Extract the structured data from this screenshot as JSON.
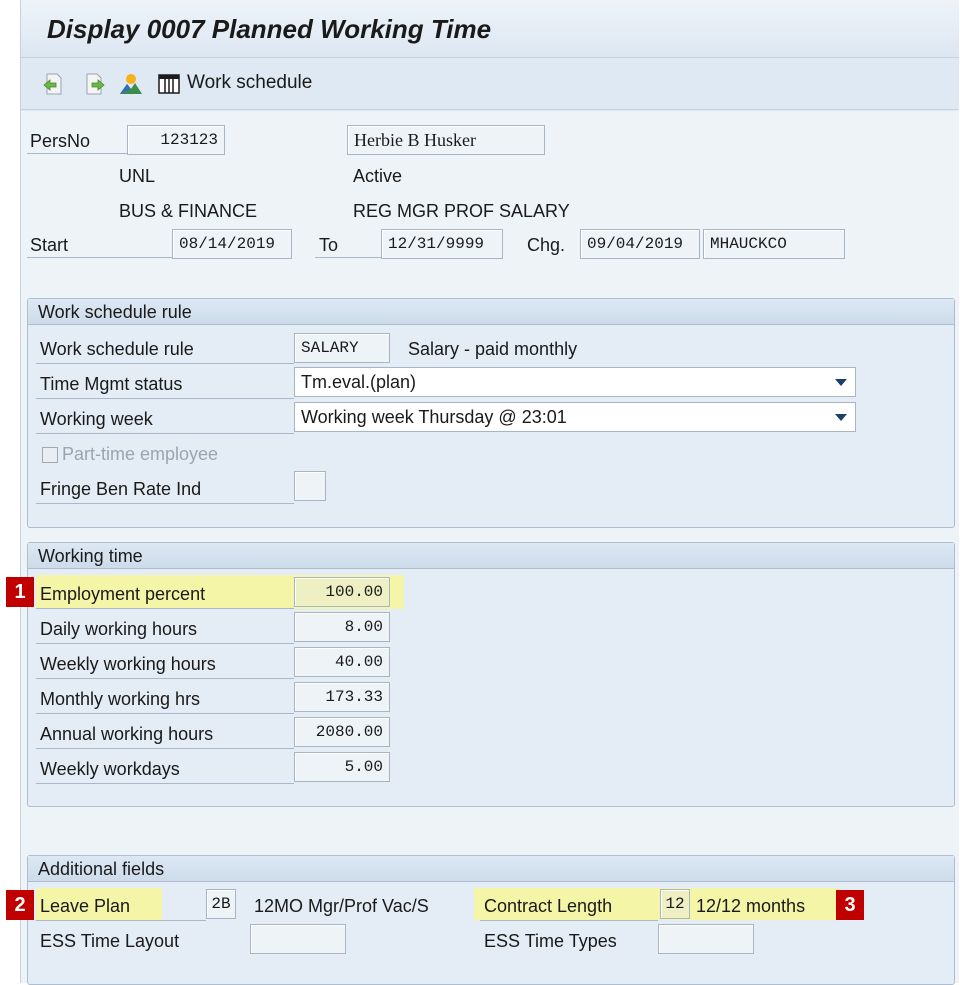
{
  "window": {
    "title": "Display 0007 Planned Working Time"
  },
  "toolbar": {
    "icons": [
      "previous-record-icon",
      "next-record-icon",
      "overview-icon",
      "work-schedule-icon"
    ],
    "work_schedule_label": "Work schedule"
  },
  "header": {
    "persno_label": "PersNo",
    "persno_value": "123123",
    "name_value": "Herbie B Husker",
    "org_unit": "UNL",
    "status": "Active",
    "department": "BUS & FINANCE",
    "position": "REG MGR PROF SALARY",
    "start_label": "Start",
    "start_value": "08/14/2019",
    "to_label": "To",
    "to_value": "12/31/9999",
    "chg_label": "Chg.",
    "chg_date": "09/04/2019",
    "chg_user": "MHAUCKCO"
  },
  "work_schedule_rule": {
    "group_title": "Work schedule rule",
    "rule_label": "Work schedule rule",
    "rule_value": "SALARY",
    "rule_desc": "Salary - paid monthly",
    "tm_status_label": "Time Mgmt status",
    "tm_status_value": "Tm.eval.(plan)",
    "working_week_label": "Working week",
    "working_week_value": "Working week Thursday @ 23:01",
    "part_time_label": "Part-time employee",
    "fringe_label": "Fringe Ben Rate Ind",
    "fringe_value": ""
  },
  "working_time": {
    "group_title": "Working time",
    "rows": [
      {
        "label": "Employment percent",
        "value": "100.00"
      },
      {
        "label": "Daily working hours",
        "value": "8.00"
      },
      {
        "label": "Weekly working hours",
        "value": "40.00"
      },
      {
        "label": "Monthly working hrs",
        "value": "173.33"
      },
      {
        "label": "Annual working hours",
        "value": "2080.00"
      },
      {
        "label": "Weekly workdays",
        "value": "5.00"
      }
    ]
  },
  "additional_fields": {
    "group_title": "Additional fields",
    "leave_plan_label": "Leave Plan",
    "leave_plan_value": "2B",
    "leave_plan_desc": "12MO Mgr/Prof Vac/S",
    "contract_length_label": "Contract Length",
    "contract_length_value": "12",
    "contract_length_desc": "12/12 months",
    "ess_layout_label": "ESS Time Layout",
    "ess_layout_value": "",
    "ess_types_label": "ESS Time Types",
    "ess_types_value": ""
  },
  "callouts": {
    "one": "1",
    "two": "2",
    "three": "3"
  },
  "colors": {
    "highlight": "#f4f5a6",
    "badge": "#c00000",
    "panel": "#e4ecf5"
  }
}
